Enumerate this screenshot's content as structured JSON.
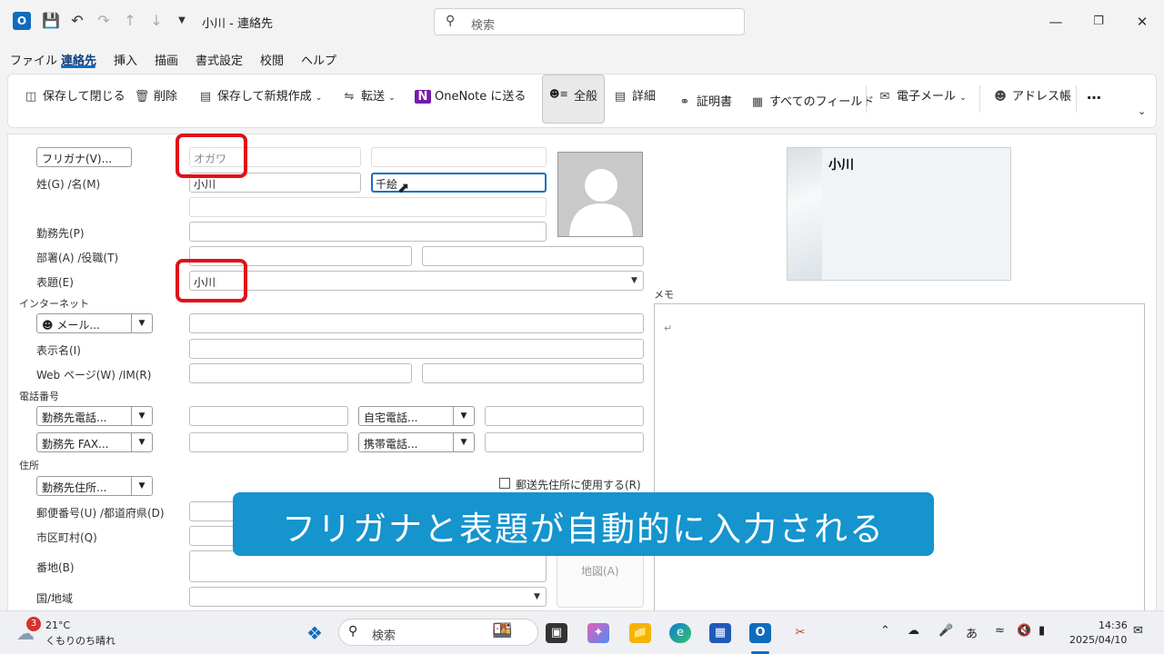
{
  "window": {
    "title": "小川 - 連絡先",
    "search_placeholder": "検索"
  },
  "menu": [
    "ファイル",
    "連絡先",
    "挿入",
    "描画",
    "書式設定",
    "校閲",
    "ヘルプ"
  ],
  "ribbon": {
    "save_close": "保存して閉じる",
    "delete": "削除",
    "save_new": "保存して新規作成",
    "forward": "転送",
    "onenote": "OneNote に送る",
    "all": "全般",
    "details": "詳細",
    "certificates": "証明書",
    "all_fields": "すべてのフィールド",
    "email": "電子メール",
    "address_book": "アドレス帳",
    "more": "…"
  },
  "form": {
    "furigana_button": "フリガナ(V)...",
    "furigana_value": "オガワ",
    "name_label": "姓(G)  /名(M)",
    "last_name": "小川",
    "first_name": "千絵",
    "company_label": "勤務先(P)",
    "dept_label": "部署(A)  /役職(T)",
    "file_as_label": "表題(E)",
    "file_as_value": "小川",
    "internet_section": "インターネット",
    "email_button": "メール...",
    "display_name_label": "表示名(I)",
    "web_label": "Web ページ(W)  /IM(R)",
    "phone_section": "電話番号",
    "business_phone": "勤務先電話...",
    "home_phone": "自宅電話...",
    "business_fax": "勤務先 FAX...",
    "mobile_phone": "携帯電話...",
    "address_section": "住所",
    "business_address": "勤務先住所...",
    "mailing_checkbox": "郵送先住所に使用する(R)",
    "postal_label": "郵便番号(U)  /都道府県(D)",
    "city_label": "市区町村(Q)",
    "street_label": "番地(B)",
    "country_label": "国/地域",
    "map_button": "地図(A)"
  },
  "card": {
    "name": "小川"
  },
  "memo": {
    "label": "メモ",
    "mark": "↵"
  },
  "banner": "フリガナと表題が自動的に入力される",
  "taskbar": {
    "weather_temp": "21°C",
    "weather_desc": "くもりのち晴れ",
    "weather_badge": "3",
    "search_placeholder": "検索",
    "time": "14:36",
    "date": "2025/04/10",
    "ime": "あ"
  },
  "colors": {
    "accent": "#0f6cbd",
    "banner": "#1594ce",
    "highlight": "#e0101a"
  }
}
